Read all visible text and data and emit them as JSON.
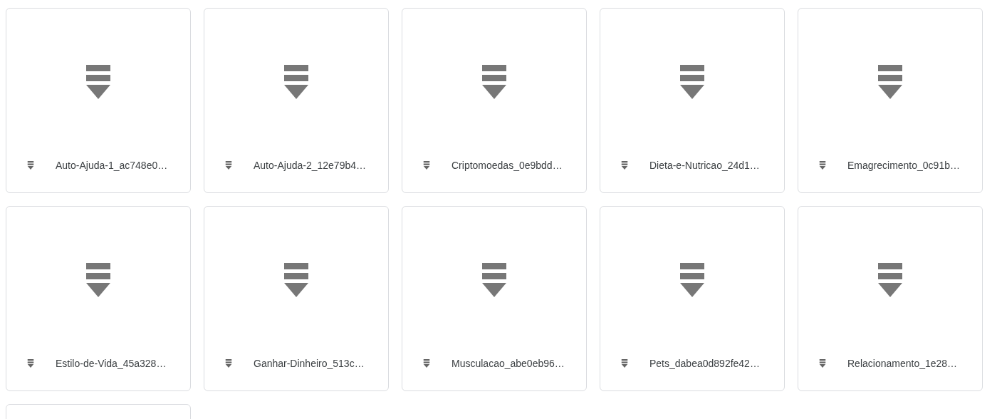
{
  "files": [
    {
      "kind": "file",
      "name": "Auto-Ajuda-1_ac748e0…"
    },
    {
      "kind": "file",
      "name": "Auto-Ajuda-2_12e79b4…"
    },
    {
      "kind": "file",
      "name": "Criptomoedas_0e9bdd…"
    },
    {
      "kind": "file",
      "name": "Dieta-e-Nutricao_24d1…"
    },
    {
      "kind": "file",
      "name": "Emagrecimento_0c91b…"
    },
    {
      "kind": "file",
      "name": "Estilo-de-Vida_45a328…"
    },
    {
      "kind": "file",
      "name": "Ganhar-Dinheiro_513c…"
    },
    {
      "kind": "file",
      "name": "Musculacao_abe0eb96…"
    },
    {
      "kind": "file",
      "name": "Pets_dabea0d892fe42…"
    },
    {
      "kind": "file",
      "name": "Relacionamento_1e28…"
    },
    {
      "kind": "partial"
    }
  ]
}
